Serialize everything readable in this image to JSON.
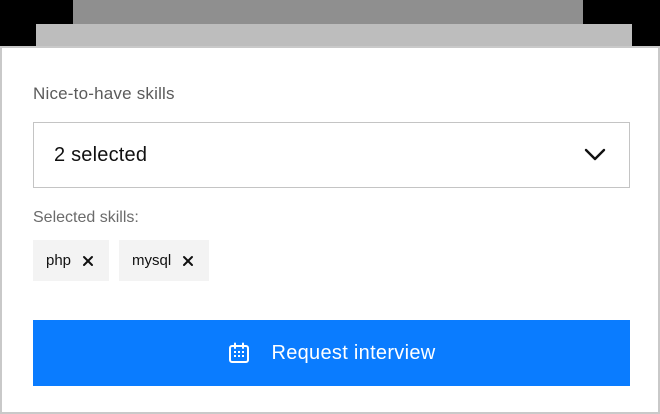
{
  "form": {
    "field_label": "Nice-to-have skills",
    "select_value": "2 selected",
    "selected_label": "Selected skills:",
    "chips": [
      {
        "label": "php"
      },
      {
        "label": "mysql"
      }
    ],
    "cta_label": "Request interview"
  },
  "icons": {
    "select": "chevron-down-icon",
    "chip_remove": "close-icon",
    "cta": "calendar-icon"
  },
  "colors": {
    "primary": "#0a7cff",
    "chip_bg": "#f3f3f3",
    "border": "#c4c4c4"
  }
}
